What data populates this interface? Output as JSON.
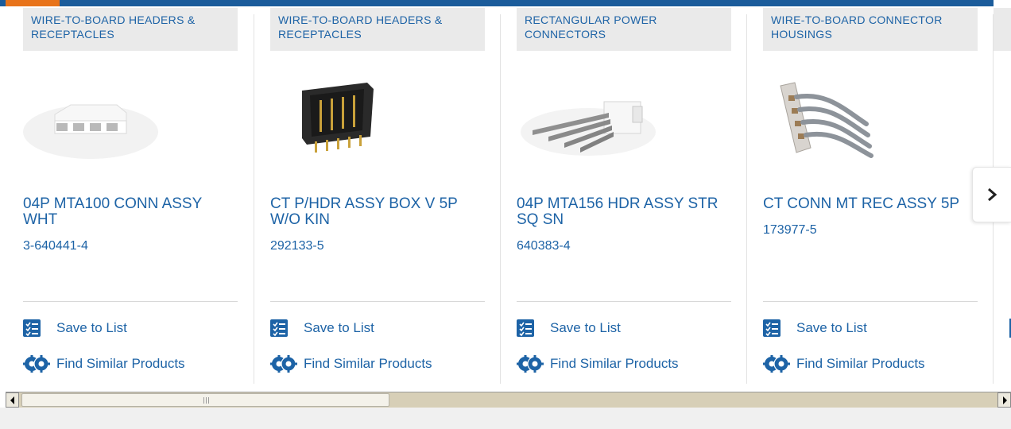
{
  "colors": {
    "brand_blue": "#1d63a6",
    "top_bar": "#1b5c9b",
    "top_accent": "#e8731a",
    "category_bg": "#eaeaea"
  },
  "products": [
    {
      "category": "WIRE-TO-BOARD HEADERS & RECEPTACLES",
      "title": "04P MTA100 CONN ASSY WHT",
      "part_number": "3-640441-4",
      "image_icon": "white-4-position-receptacle",
      "save_label": "Save to List",
      "similar_label": "Find Similar Products"
    },
    {
      "category": "WIRE-TO-BOARD HEADERS & RECEPTACLES",
      "title": "CT P/HDR ASSY BOX V 5P W/O KIN",
      "part_number": "292133-5",
      "image_icon": "black-box-header-5-pin",
      "save_label": "Save to List",
      "similar_label": "Find Similar Products"
    },
    {
      "category": "RECTANGULAR POWER CONNECTORS",
      "title": "04P MTA156 HDR ASSY STR SQ SN",
      "part_number": "640383-4",
      "image_icon": "white-header-4-straight-pins",
      "save_label": "Save to List",
      "similar_label": "Find Similar Products"
    },
    {
      "category": "WIRE-TO-BOARD CONNECTOR HOUSINGS",
      "title": "CT CONN MT REC ASSY 5P",
      "part_number": "173977-5",
      "image_icon": "receptacle-with-bent-wires",
      "save_label": "Save to List",
      "similar_label": "Find Similar Products"
    }
  ],
  "carousel": {
    "next_icon": "chevron-right-icon"
  },
  "scrollbar": {
    "left_icon": "arrow-left-icon",
    "right_icon": "arrow-right-icon",
    "position": 0.0
  }
}
